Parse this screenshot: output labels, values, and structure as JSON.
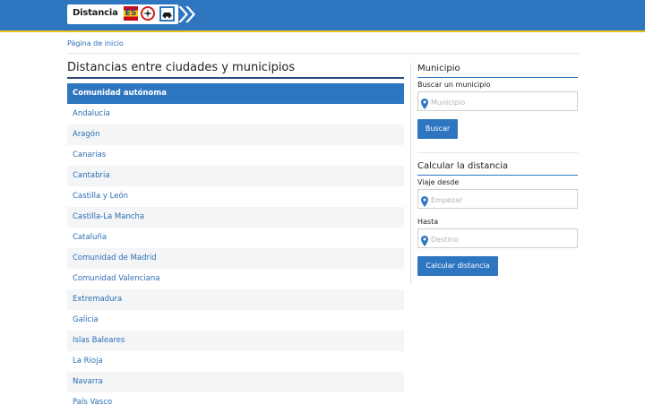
{
  "header": {
    "logo_text": "Distancia",
    "logo_badge": "ES",
    "colors": {
      "bar": "#2f76c1",
      "stripe": "#e8c21a"
    },
    "icons": [
      "airplane-icon",
      "car-icon",
      "chevron-arrows-icon"
    ]
  },
  "breadcrumb": {
    "home": "Página de inicio"
  },
  "main": {
    "title": "Distancias entre ciudades y municipios",
    "table": {
      "header": "Comunidad autónoma",
      "rows": [
        "Andalucía",
        "Aragón",
        "Canarias",
        "Cantabria",
        "Castilla y León",
        "Castilla-La Mancha",
        "Cataluña",
        "Comunidad de Madrid",
        "Comunidad Valenciana",
        "Extremadura",
        "Galicia",
        "Islas Baleares",
        "La Rioja",
        "Navarra",
        "País Vasco"
      ]
    }
  },
  "sidebar": {
    "municipio": {
      "heading": "Municipio",
      "label": "Buscar un municipio",
      "placeholder": "Municipio",
      "button": "Buscar"
    },
    "distance": {
      "heading": "Calcular la distancia",
      "from_label": "Viaje desde",
      "from_placeholder": "Empezar",
      "to_label": "Hasta",
      "to_placeholder": "Destino",
      "button": "Calcular distancia"
    }
  }
}
